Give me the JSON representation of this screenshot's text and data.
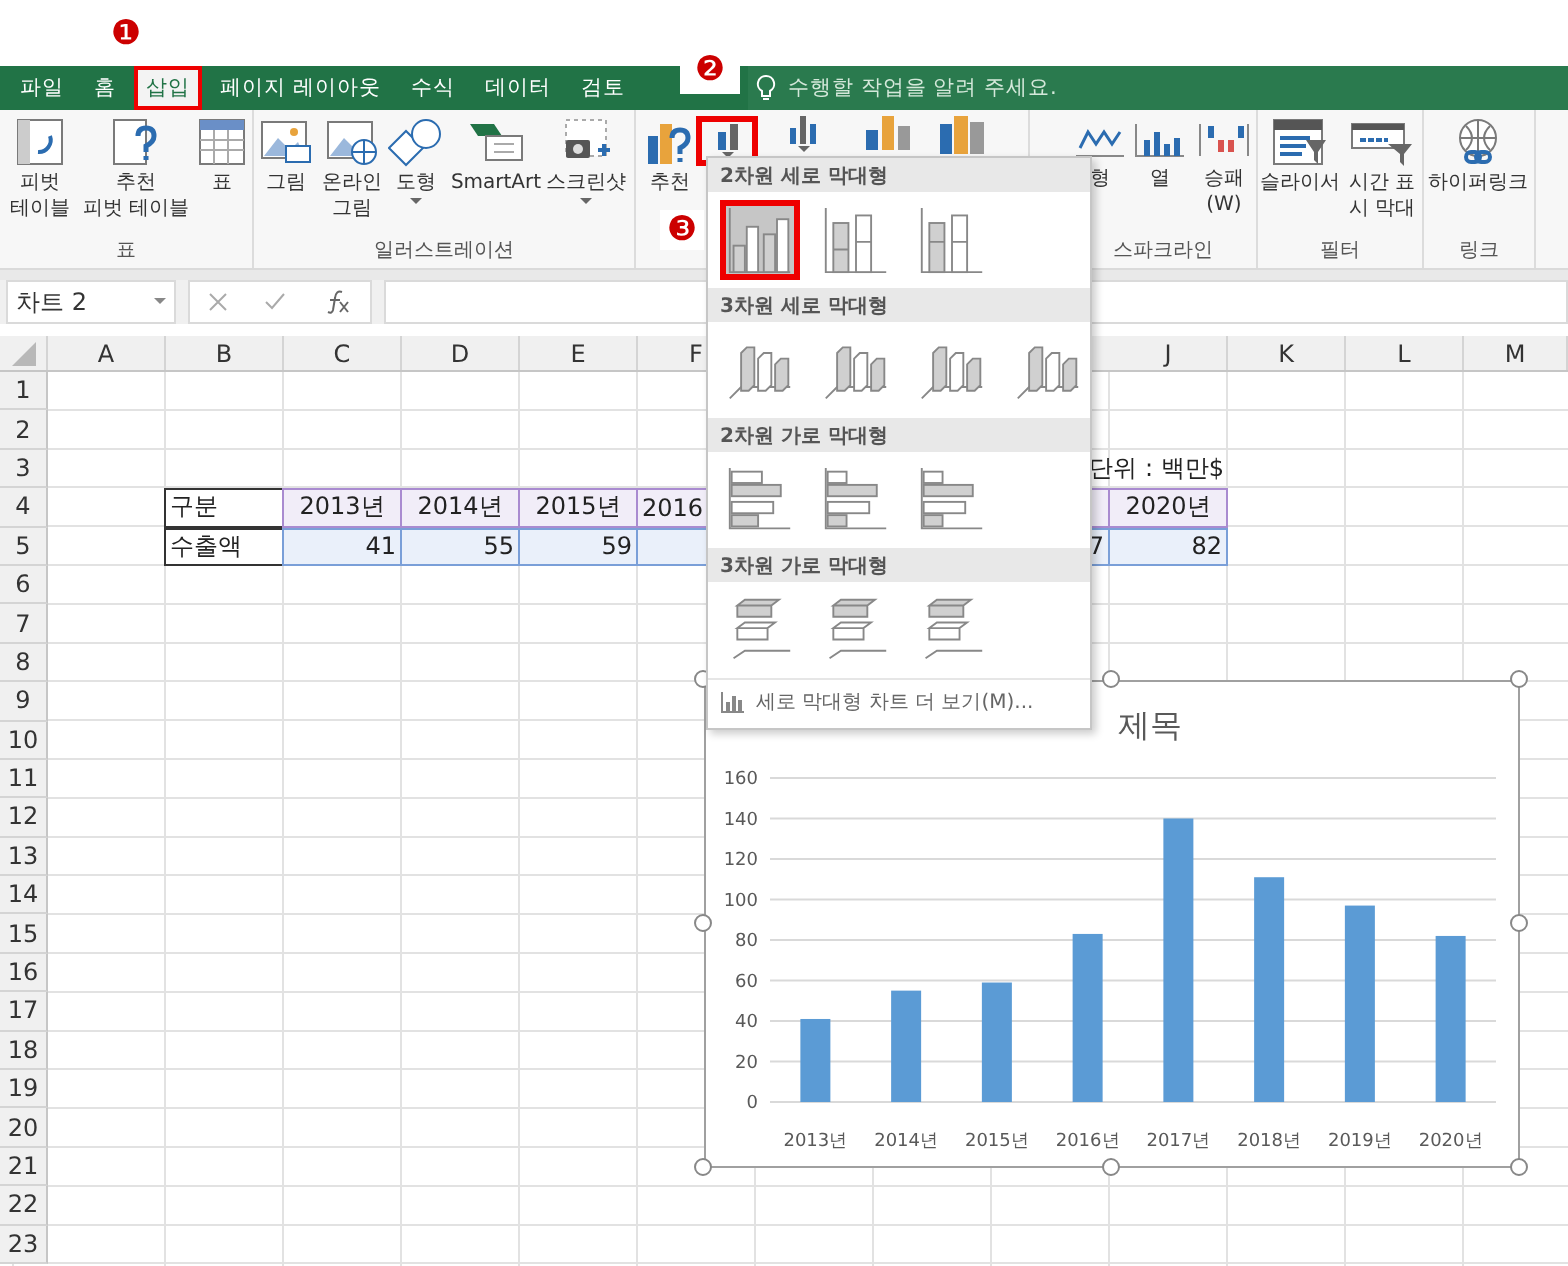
{
  "annotations": [
    {
      "number": "❶"
    },
    {
      "number": "❷"
    },
    {
      "number": "❸"
    }
  ],
  "tabs": [
    {
      "label": "파일",
      "selected": false,
      "highlighted": false
    },
    {
      "label": "홈",
      "selected": false,
      "highlighted": false
    },
    {
      "label": "삽입",
      "selected": true,
      "highlighted": true
    },
    {
      "label": "페이지 레이아웃",
      "selected": false,
      "highlighted": false
    },
    {
      "label": "수식",
      "selected": false,
      "highlighted": false
    },
    {
      "label": "데이터",
      "selected": false,
      "highlighted": false
    },
    {
      "label": "검토",
      "selected": false,
      "highlighted": false
    }
  ],
  "search": {
    "placeholder": "수행할 작업을 알려 주세요."
  },
  "ribbon": {
    "groups": [
      {
        "label": "표",
        "buttons": [
          {
            "lines": [
              "피벗",
              "테이블"
            ]
          },
          {
            "lines": [
              "추천",
              "피벗 테이블"
            ]
          },
          {
            "lines": [
              "표"
            ]
          }
        ]
      },
      {
        "label": "일러스트레이션",
        "buttons": [
          {
            "lines": [
              "그림"
            ]
          },
          {
            "lines": [
              "온라인",
              "그림"
            ]
          },
          {
            "lines": [
              "도형"
            ],
            "dropdown": true
          },
          {
            "lines": [
              "SmartArt"
            ]
          },
          {
            "lines": [
              "스크린샷"
            ],
            "dropdown": true
          }
        ]
      },
      {
        "buttons": [
          {
            "lines": [
              "추천"
            ]
          },
          {
            "highlighted": true,
            "dropdown": true
          },
          {
            "dropdown": true
          },
          {
            "dropdown": false
          },
          {
            "dropdown": false
          }
        ]
      },
      {
        "label": "스파크라인",
        "buttons": [
          {
            "lines": [
              "형"
            ]
          },
          {
            "lines": [
              "열"
            ]
          },
          {
            "lines": [
              "승패",
              "(W)"
            ]
          }
        ]
      },
      {
        "label": "필터",
        "buttons": [
          {
            "lines": [
              "슬라이서"
            ]
          },
          {
            "lines": [
              "시간 표",
              "시 막대"
            ]
          }
        ]
      },
      {
        "label": "링크",
        "buttons": [
          {
            "lines": [
              "하이퍼링크"
            ]
          }
        ]
      }
    ]
  },
  "formula_bar": {
    "name_box": "차트 2"
  },
  "sheet": {
    "columns": [
      "A",
      "B",
      "C",
      "D",
      "E",
      "F",
      "J",
      "K",
      "L",
      "M"
    ],
    "rows": [
      "1",
      "2",
      "3",
      "4",
      "5",
      "6",
      "7",
      "8",
      "9",
      "10",
      "11",
      "12",
      "13",
      "14",
      "15",
      "16",
      "17",
      "18",
      "19",
      "20",
      "21",
      "22",
      "23"
    ],
    "unit_note": "단위 : 백만$",
    "table": [
      {
        "cells": [
          {
            "kind": "label",
            "text": "구분"
          },
          {
            "kind": "year",
            "text": "2013년"
          },
          {
            "kind": "year",
            "text": "2014년"
          },
          {
            "kind": "year",
            "text": "2015년"
          },
          {
            "kind": "year",
            "text": "2016",
            "cut": true
          },
          {
            "kind": "year"
          },
          {
            "kind": "year",
            "text": "2020년"
          }
        ]
      },
      {
        "cells": [
          {
            "kind": "label",
            "text": "수출액"
          },
          {
            "kind": "number",
            "text": "41"
          },
          {
            "kind": "number",
            "text": "55"
          },
          {
            "kind": "number",
            "text": "59"
          },
          {
            "kind": "number"
          },
          {
            "kind": "number",
            "text": "7"
          },
          {
            "kind": "number",
            "text": "82"
          }
        ]
      }
    ]
  },
  "chart": {
    "chart_data": {
      "type": "bar",
      "title": "제목",
      "grid": true,
      "categories": [
        "2013년",
        "2014년",
        "2015년",
        "2016년",
        "2017년",
        "2018년",
        "2019년",
        "2020년"
      ],
      "series": [
        {
          "color": "#5b9bd5",
          "values": [
            41,
            55,
            59,
            83,
            140,
            111,
            97,
            82
          ]
        }
      ],
      "ylim": [
        0,
        160
      ],
      "yticks": [
        0,
        20,
        40,
        60,
        80,
        100,
        120,
        140,
        160
      ]
    }
  },
  "chart_menu": {
    "sections": [
      {
        "title": "2차원 세로 막대형",
        "kind": "column2d",
        "items": [
          {
            "selected": true,
            "highlighted": true
          },
          {
            "selected": false,
            "highlighted": false
          },
          {
            "selected": false,
            "highlighted": false
          }
        ]
      },
      {
        "title": "3차원 세로 막대형",
        "kind": "column3d",
        "items": [
          {
            "selected": false,
            "highlighted": false
          },
          {
            "selected": false,
            "highlighted": false
          },
          {
            "selected": false,
            "highlighted": false
          },
          {
            "selected": false,
            "highlighted": false
          }
        ]
      },
      {
        "title": "2차원 가로 막대형",
        "kind": "bar2d",
        "items": [
          {
            "selected": false,
            "highlighted": false
          },
          {
            "selected": false,
            "highlighted": false
          },
          {
            "selected": false,
            "highlighted": false
          }
        ]
      },
      {
        "title": "3차원 가로 막대형",
        "kind": "bar3d",
        "items": [
          {
            "selected": false,
            "highlighted": false
          },
          {
            "selected": false,
            "highlighted": false
          },
          {
            "selected": false,
            "highlighted": false
          }
        ]
      }
    ],
    "footer": "세로 막대형 차트 더 보기(M)..."
  }
}
